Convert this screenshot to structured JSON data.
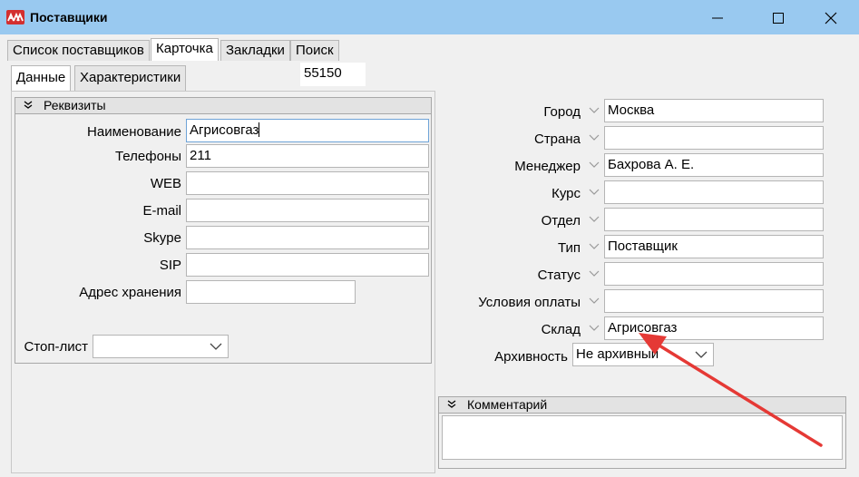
{
  "window": {
    "title": "Поставщики",
    "icon": "app-logo-icon",
    "controls": [
      "minimize-icon",
      "maximize-icon",
      "close-icon"
    ]
  },
  "main_tabs": [
    {
      "label": "Список поставщиков"
    },
    {
      "label": "Карточка"
    },
    {
      "label": "Закладки"
    },
    {
      "label": "Поиск"
    }
  ],
  "main_tabs_active": "Карточка",
  "sub_tabs": [
    {
      "label": "Данные"
    },
    {
      "label": "Характеристики"
    }
  ],
  "sub_tabs_active": "Данные",
  "record_id": "55150",
  "requisites": {
    "title": "Реквизиты",
    "fields": [
      {
        "label": "Наименование",
        "value": "Агрисовгаз"
      },
      {
        "label": "Телефоны",
        "value": "211"
      },
      {
        "label": "WEB",
        "value": ""
      },
      {
        "label": "E-mail",
        "value": ""
      },
      {
        "label": "Skype",
        "value": ""
      },
      {
        "label": "SIP",
        "value": ""
      },
      {
        "label": "Адрес хранения",
        "value": ""
      }
    ],
    "stop_list": {
      "label": "Стоп-лист",
      "value": ""
    }
  },
  "right_fields": [
    {
      "label": "Город",
      "value": "Москва"
    },
    {
      "label": "Страна",
      "value": ""
    },
    {
      "label": "Менеджер",
      "value": "Бахрова А. Е."
    },
    {
      "label": "Курс",
      "value": ""
    },
    {
      "label": "Отдел",
      "value": ""
    },
    {
      "label": "Тип",
      "value": "Поставщик"
    },
    {
      "label": "Статус",
      "value": ""
    },
    {
      "label": "Условия оплаты",
      "value": ""
    },
    {
      "label": "Склад",
      "value": "Агрисовгаз"
    }
  ],
  "archive": {
    "label": "Архивность",
    "value": "Не архивный"
  },
  "comment": {
    "title": "Комментарий",
    "value": ""
  },
  "colors": {
    "titlebar": "#99c9f0",
    "annotation_arrow": "#e53935"
  }
}
